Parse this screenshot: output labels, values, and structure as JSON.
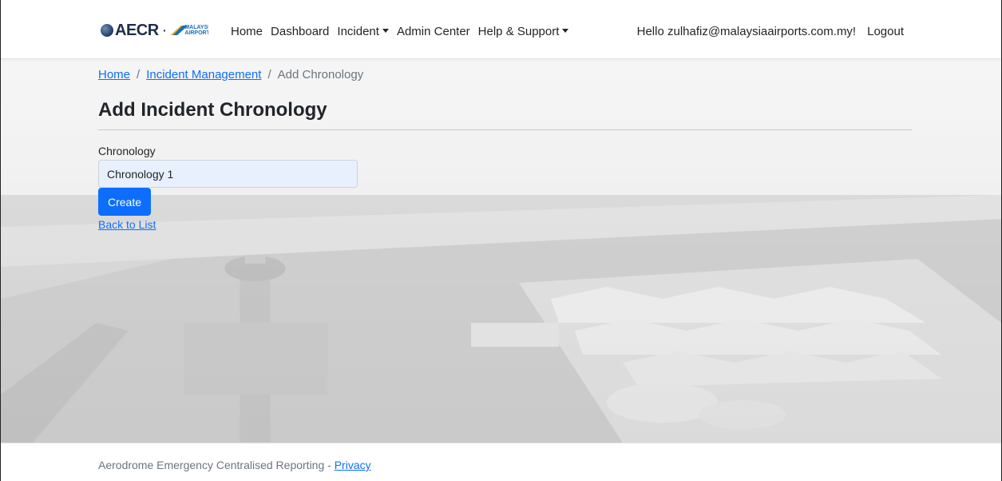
{
  "navbar": {
    "brand_text": "AECR",
    "brand_dot": "·",
    "partner_logo_text": "MALAYSIA AIRPORTS",
    "links": [
      {
        "label": "Home"
      },
      {
        "label": "Dashboard"
      },
      {
        "label": "Incident",
        "dropdown": true
      },
      {
        "label": "Admin Center"
      },
      {
        "label": "Help & Support",
        "dropdown": true
      }
    ],
    "greeting": "Hello zulhafiz@malaysiaairports.com.my!",
    "logout_label": "Logout"
  },
  "breadcrumb": {
    "items": [
      "Home",
      "Incident Management",
      "Add Chronology"
    ],
    "separator": "/"
  },
  "page": {
    "title": "Add Incident Chronology"
  },
  "form": {
    "chronology_label": "Chronology",
    "chronology_value": "Chronology 1",
    "create_label": "Create",
    "back_label": "Back to List"
  },
  "footer": {
    "text": "Aerodrome Emergency Centralised Reporting - ",
    "privacy_label": "Privacy"
  },
  "colors": {
    "primary": "#0d6efd",
    "input_autofill_bg": "#e8f0fe",
    "text": "#212529",
    "muted": "#6c757d"
  }
}
